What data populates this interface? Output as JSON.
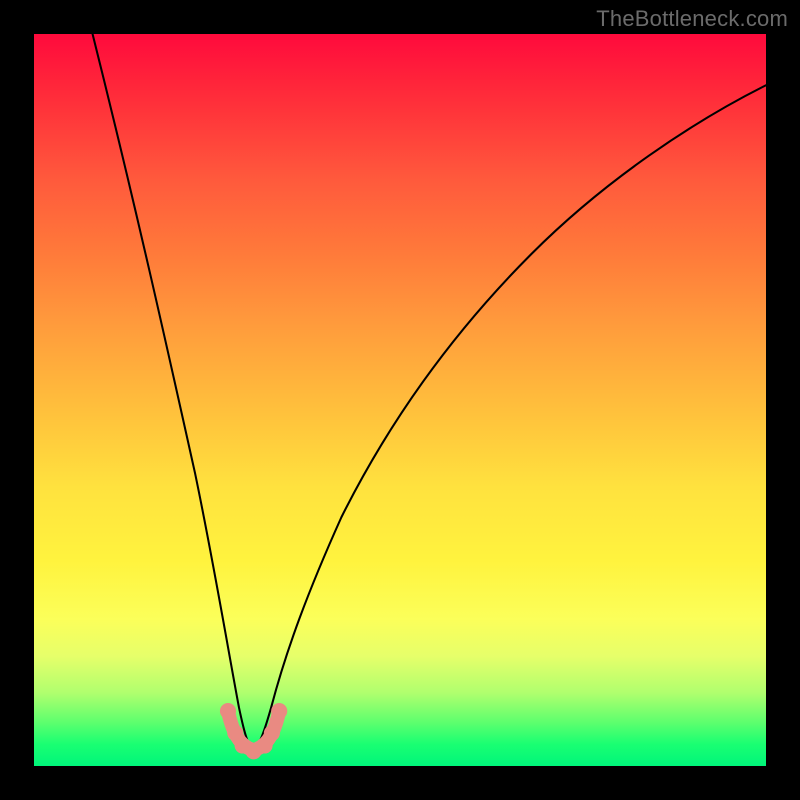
{
  "watermark": "TheBottleneck.com",
  "chart_data": {
    "type": "line",
    "title": "",
    "xlabel": "",
    "ylabel": "",
    "xlim": [
      0,
      100
    ],
    "ylim": [
      0,
      100
    ],
    "grid": false,
    "legend": false,
    "notch_x": 30,
    "series": [
      {
        "name": "bottleneck-curve",
        "color": "#000000",
        "x": [
          8,
          12,
          16,
          20,
          23,
          26,
          28,
          29.5,
          31,
          33,
          36,
          40,
          45,
          52,
          60,
          70,
          82,
          95,
          100
        ],
        "y": [
          100,
          83,
          66,
          49,
          34,
          20,
          10,
          4,
          4,
          8,
          16,
          26,
          38,
          52,
          64,
          75,
          84,
          91,
          93
        ]
      },
      {
        "name": "notch-markers",
        "type": "scatter",
        "color": "#e98a82",
        "x": [
          26.5,
          27.5,
          28.5,
          29.5,
          30.5,
          31.5,
          32.5,
          33.5
        ],
        "y": [
          7.5,
          4.5,
          2.8,
          2.0,
          2.0,
          2.8,
          4.5,
          7.5
        ]
      }
    ],
    "background_gradient": {
      "top": "#ff0a3c",
      "mid": "#ffe23e",
      "bottom": "#00f57a"
    }
  }
}
